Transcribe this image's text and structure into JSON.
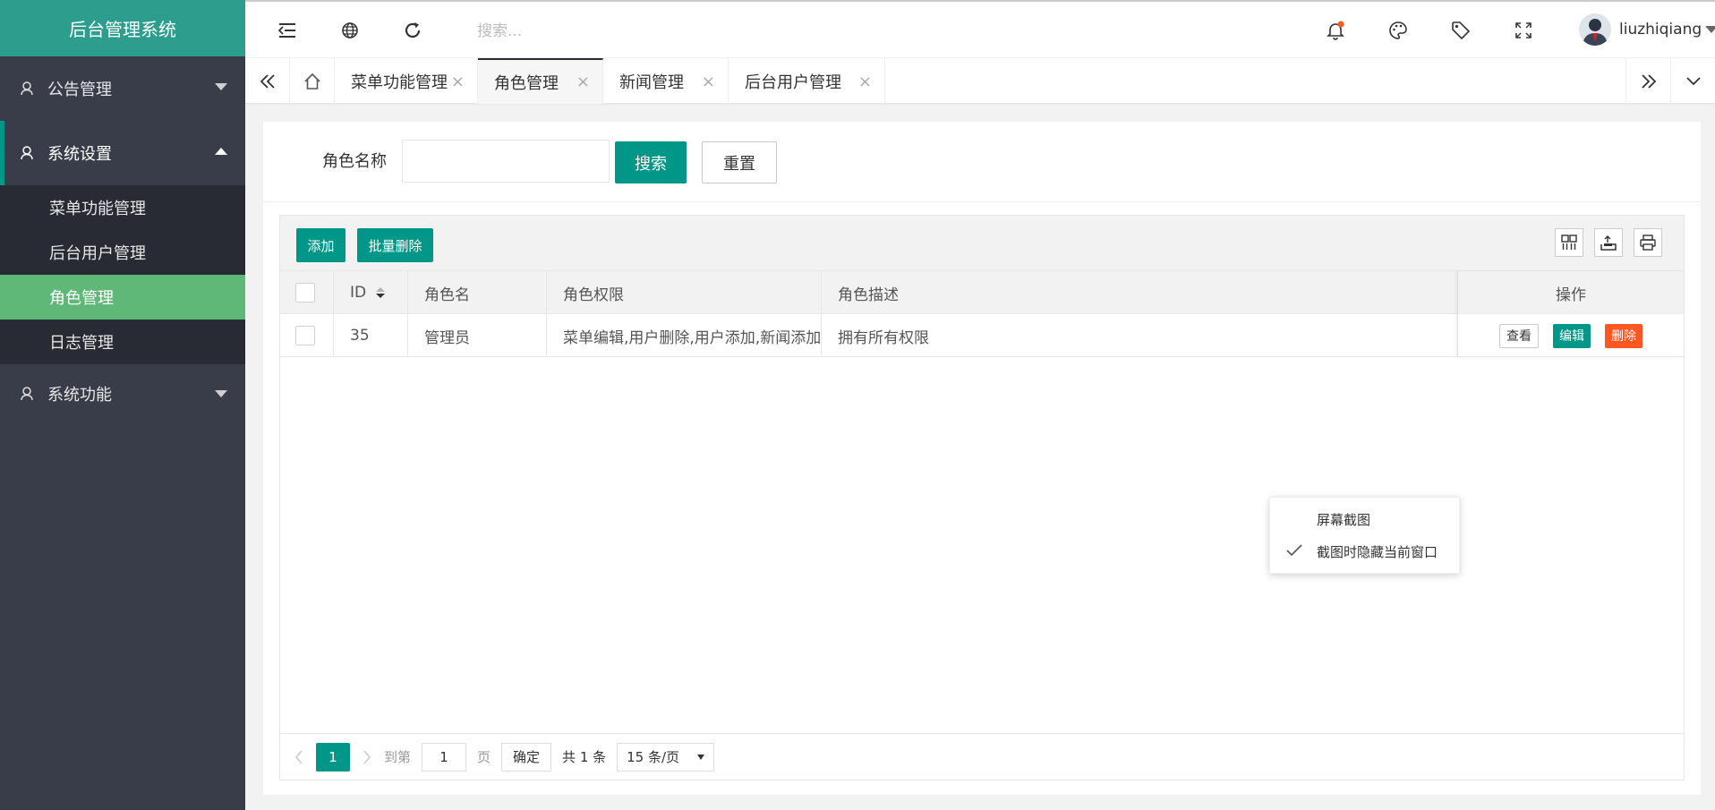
{
  "sidebar": {
    "title": "后台管理系统",
    "groups": [
      {
        "label": "公告管理"
      },
      {
        "label": "系统设置",
        "items": [
          "菜单功能管理",
          "后台用户管理",
          "角色管理",
          "日志管理"
        ]
      },
      {
        "label": "系统功能"
      }
    ]
  },
  "header": {
    "search_placeholder": "搜索...",
    "username": "liuzhiqiang"
  },
  "tabs": [
    "菜单功能管理",
    "角色管理",
    "新闻管理",
    "后台用户管理"
  ],
  "search_form": {
    "label": "角色名称",
    "search_button": "搜索",
    "reset_button": "重置"
  },
  "toolbar": {
    "add_button": "添加",
    "batch_delete_button": "批量删除"
  },
  "table": {
    "columns": [
      "ID",
      "角色名",
      "角色权限",
      "角色描述",
      "操作"
    ],
    "rows": [
      {
        "id": "35",
        "name": "管理员",
        "permissions": "菜单编辑,用户删除,用户添加,新闻添加,菜...",
        "description": "拥有所有权限"
      }
    ],
    "actions": {
      "view": "查看",
      "edit": "编辑",
      "delete": "删除"
    }
  },
  "pager": {
    "current_page": "1",
    "goto_label": "到第",
    "goto_value": "1",
    "page_unit": "页",
    "confirm": "确定",
    "total": "共 1 条",
    "page_size": "15 条/页"
  },
  "context_menu": {
    "items": [
      "屏幕截图",
      "截图时隐藏当前窗口"
    ]
  },
  "colors": {
    "primary": "#009688",
    "danger": "#ff5722",
    "sidebar": "#393d49",
    "active_item": "#5fb878",
    "logo": "#2d9d8d"
  }
}
